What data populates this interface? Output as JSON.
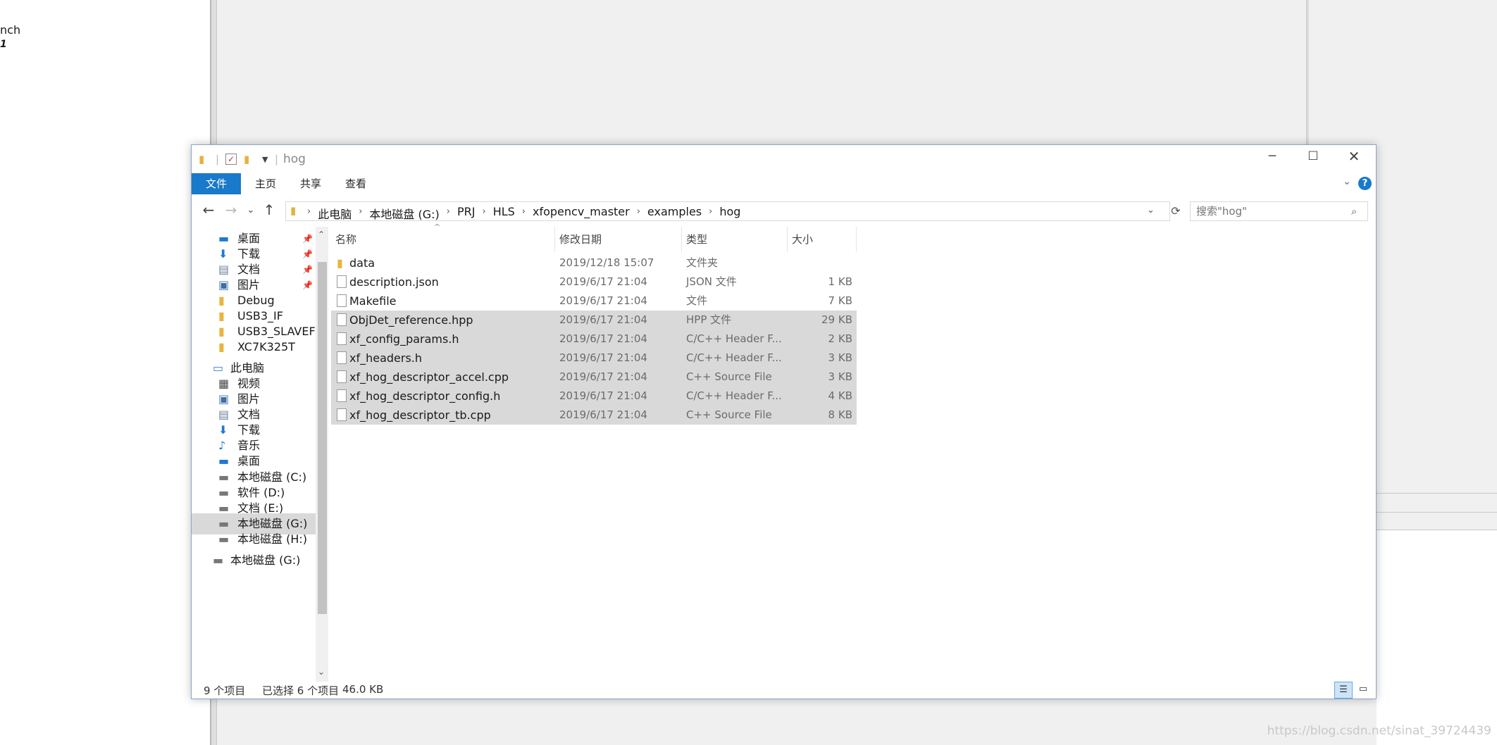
{
  "background": {
    "left_text_1": "nch",
    "left_text_2": "1",
    "watermark": "https://blog.csdn.net/sinat_39724439"
  },
  "window": {
    "title": "hog"
  },
  "ribbon": {
    "tabs": [
      "文件",
      "主页",
      "共享",
      "查看"
    ]
  },
  "navigation": {
    "crumbs": [
      "此电脑",
      "本地磁盘 (G:)",
      "PRJ",
      "HLS",
      "xfopencv_master",
      "examples",
      "hog"
    ],
    "search_placeholder": "搜索\"hog\""
  },
  "sidebar": {
    "items": [
      {
        "label": "桌面",
        "icon": "desktop-icon",
        "pinned": true
      },
      {
        "label": "下载",
        "icon": "download-icon",
        "pinned": true
      },
      {
        "label": "文档",
        "icon": "document-icon",
        "pinned": true
      },
      {
        "label": "图片",
        "icon": "picture-icon",
        "pinned": true
      },
      {
        "label": "Debug",
        "icon": "folder-icon",
        "pinned": false
      },
      {
        "label": "USB3_IF",
        "icon": "folder-icon",
        "pinned": false
      },
      {
        "label": "USB3_SLAVEFIF",
        "icon": "folder-icon",
        "pinned": false
      },
      {
        "label": "XC7K325T",
        "icon": "folder-icon",
        "pinned": false
      },
      {
        "label": "此电脑",
        "icon": "computer-icon",
        "pinned": false
      },
      {
        "label": "视频",
        "icon": "video-icon",
        "pinned": false
      },
      {
        "label": "图片",
        "icon": "picture-icon",
        "pinned": false
      },
      {
        "label": "文档",
        "icon": "document-icon",
        "pinned": false
      },
      {
        "label": "下载",
        "icon": "download-icon",
        "pinned": false
      },
      {
        "label": "音乐",
        "icon": "music-icon",
        "pinned": false
      },
      {
        "label": "桌面",
        "icon": "desktop-icon",
        "pinned": false
      },
      {
        "label": "本地磁盘 (C:)",
        "icon": "drive-icon",
        "pinned": false
      },
      {
        "label": "软件 (D:)",
        "icon": "drive-icon",
        "pinned": false
      },
      {
        "label": "文档 (E:)",
        "icon": "drive-icon",
        "pinned": false
      },
      {
        "label": "本地磁盘 (G:)",
        "icon": "drive-icon",
        "pinned": false,
        "selected": true
      },
      {
        "label": "本地磁盘 (H:)",
        "icon": "drive-icon",
        "pinned": false
      },
      {
        "label": "本地磁盘 (G:)",
        "icon": "drive-icon",
        "pinned": false
      }
    ]
  },
  "columns": {
    "name": "名称",
    "date": "修改日期",
    "type": "类型",
    "size": "大小"
  },
  "files": [
    {
      "name": "data",
      "date": "2019/12/18 15:07",
      "type": "文件夹",
      "size": "",
      "kind": "folder",
      "selected": false
    },
    {
      "name": "description.json",
      "date": "2019/6/17 21:04",
      "type": "JSON 文件",
      "size": "1 KB",
      "kind": "file",
      "selected": false
    },
    {
      "name": "Makefile",
      "date": "2019/6/17 21:04",
      "type": "文件",
      "size": "7 KB",
      "kind": "file",
      "selected": false
    },
    {
      "name": "ObjDet_reference.hpp",
      "date": "2019/6/17 21:04",
      "type": "HPP 文件",
      "size": "29 KB",
      "kind": "file",
      "selected": true
    },
    {
      "name": "xf_config_params.h",
      "date": "2019/6/17 21:04",
      "type": "C/C++ Header F...",
      "size": "2 KB",
      "kind": "file",
      "selected": true
    },
    {
      "name": "xf_headers.h",
      "date": "2019/6/17 21:04",
      "type": "C/C++ Header F...",
      "size": "3 KB",
      "kind": "file",
      "selected": true
    },
    {
      "name": "xf_hog_descriptor_accel.cpp",
      "date": "2019/6/17 21:04",
      "type": "C++ Source File",
      "size": "3 KB",
      "kind": "file",
      "selected": true
    },
    {
      "name": "xf_hog_descriptor_config.h",
      "date": "2019/6/17 21:04",
      "type": "C/C++ Header F...",
      "size": "4 KB",
      "kind": "file",
      "selected": true
    },
    {
      "name": "xf_hog_descriptor_tb.cpp",
      "date": "2019/6/17 21:04",
      "type": "C++ Source File",
      "size": "8 KB",
      "kind": "file",
      "selected": true
    }
  ],
  "status": {
    "count": "9 个项目",
    "selected": "已选择 6 个项目",
    "size": "46.0 KB"
  },
  "colors": {
    "accent": "#1979ca",
    "selection": "#d9d9d9",
    "folder": "#e8b43c"
  }
}
